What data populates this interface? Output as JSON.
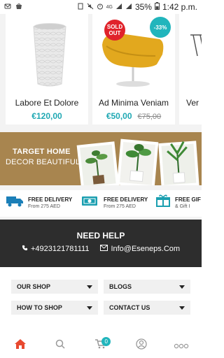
{
  "status_bar": {
    "battery": "35%",
    "time": "1:42 p.m.",
    "network": "4G"
  },
  "products": [
    {
      "name": "Labore Et Dolore",
      "price": "€120,00",
      "old_price": ""
    },
    {
      "name": "Ad Minima Veniam",
      "price": "€50,00",
      "old_price": "€75,00",
      "badge_sold": [
        "SOLD",
        "OUT"
      ],
      "badge_discount": "-33%"
    },
    {
      "name": "Ver"
    }
  ],
  "banner": {
    "line1": "TARGET HOME",
    "line2": "DECOR BEAUTIFUL"
  },
  "features": [
    {
      "title": "FREE DELIVERY",
      "subtitle": "From 275 AED",
      "icon": "truck-icon"
    },
    {
      "title": "FREE DELIVERY",
      "subtitle": "From 275 AED",
      "icon": "money-icon"
    },
    {
      "title": "FREE GIF",
      "subtitle": "& Gift I",
      "icon": "gift-icon"
    }
  ],
  "help": {
    "title": "NEED HELP",
    "phone": "+4923121781111",
    "email": "Info@Eseneps.Com"
  },
  "menus": {
    "our_shop": "OUR SHOP",
    "blogs": "BLOGS",
    "how_to_shop": "HOW TO SHOP",
    "contact_us": "CONTACT US"
  },
  "bottom_nav": {
    "cart_count": "0"
  },
  "colors": {
    "accent": "#21b5bc",
    "price": "#1fa8b3",
    "sold_out": "#e0232b",
    "banner": "#a8854f",
    "help_bg": "#2d2d2d",
    "home_active": "#e8492f"
  }
}
